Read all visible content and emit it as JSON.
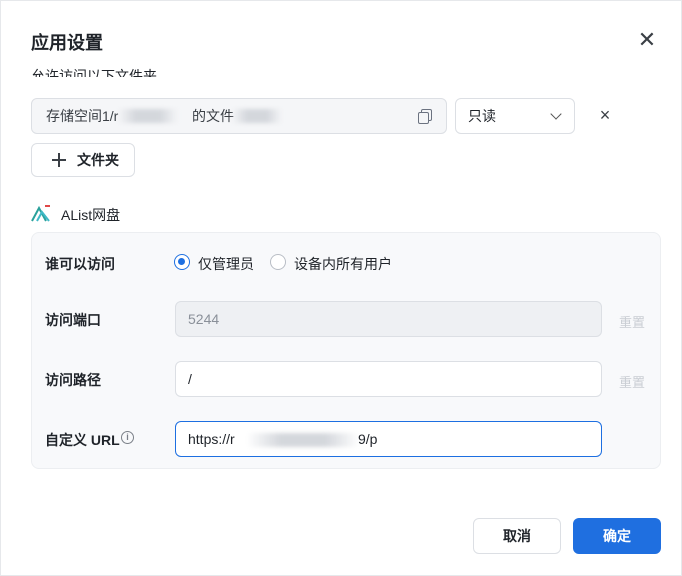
{
  "dialog": {
    "title": "应用设置"
  },
  "folder_row": {
    "cut_label": "允许访问以下文件夹",
    "path_prefix": "存储空间1/r",
    "path_middle": "的文件",
    "permission": "只读"
  },
  "add_folder_label": "文件夹",
  "section": {
    "name": "AList网盘"
  },
  "access": {
    "label": "谁可以访问",
    "options": [
      {
        "label": "仅管理员",
        "selected": true
      },
      {
        "label": "设备内所有用户",
        "selected": false
      }
    ]
  },
  "port": {
    "label": "访问端口",
    "value": "5244",
    "reset": "重置"
  },
  "path": {
    "label": "访问路径",
    "value": "/",
    "reset": "重置"
  },
  "url": {
    "label": "自定义 URL",
    "value_prefix": "https://r",
    "value_suffix": "9/p"
  },
  "footer": {
    "cancel": "取消",
    "ok": "确定"
  },
  "colors": {
    "primary": "#1f6fe0",
    "panel_bg": "#f8f9fb"
  }
}
